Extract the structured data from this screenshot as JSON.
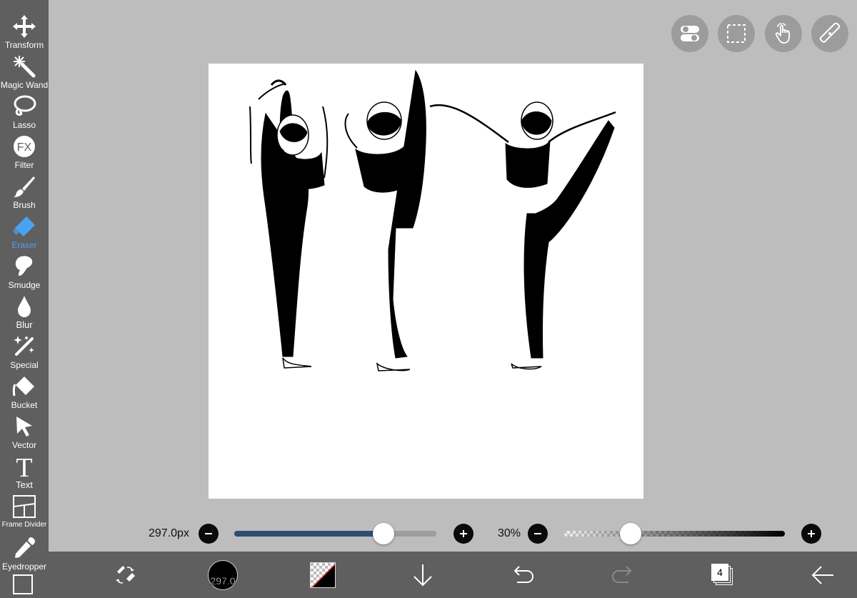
{
  "tools": [
    {
      "id": "transform",
      "label": "Transform",
      "icon": "move-arrows-icon"
    },
    {
      "id": "magic-wand",
      "label": "Magic Wand",
      "icon": "magic-wand-icon"
    },
    {
      "id": "lasso",
      "label": "Lasso",
      "icon": "lasso-icon"
    },
    {
      "id": "filter",
      "label": "Filter",
      "icon": "fx-icon",
      "glyph": "FX"
    },
    {
      "id": "brush",
      "label": "Brush",
      "icon": "brush-icon"
    },
    {
      "id": "eraser",
      "label": "Eraser",
      "icon": "eraser-icon",
      "active": true
    },
    {
      "id": "smudge",
      "label": "Smudge",
      "icon": "smudge-icon"
    },
    {
      "id": "blur",
      "label": "Blur",
      "icon": "droplet-icon"
    },
    {
      "id": "special",
      "label": "Special",
      "icon": "sparkle-pen-icon"
    },
    {
      "id": "bucket",
      "label": "Bucket",
      "icon": "bucket-icon"
    },
    {
      "id": "vector",
      "label": "Vector",
      "icon": "cursor-arrow-icon"
    },
    {
      "id": "text",
      "label": "Text",
      "icon": "text-t-icon",
      "glyph": "T"
    },
    {
      "id": "frame-divider",
      "label": "Frame Divider",
      "icon": "frame-divider-icon"
    },
    {
      "id": "eyedropper",
      "label": "Eyedropper",
      "icon": "eyedropper-icon"
    }
  ],
  "brush_size": {
    "display": "297.0px",
    "percent_of_range": 0.74
  },
  "opacity": {
    "display": "30%",
    "percent_of_range": 0.3
  },
  "bottom_bar": {
    "brush_preview_value": "297.0",
    "layer_count": "4"
  },
  "colors": {
    "accent_blue": "#4aa3f0",
    "size_track_fill": "#2e4d72",
    "panel_gray": "#5f5f5f",
    "workspace_gray": "#bdbdbd"
  }
}
